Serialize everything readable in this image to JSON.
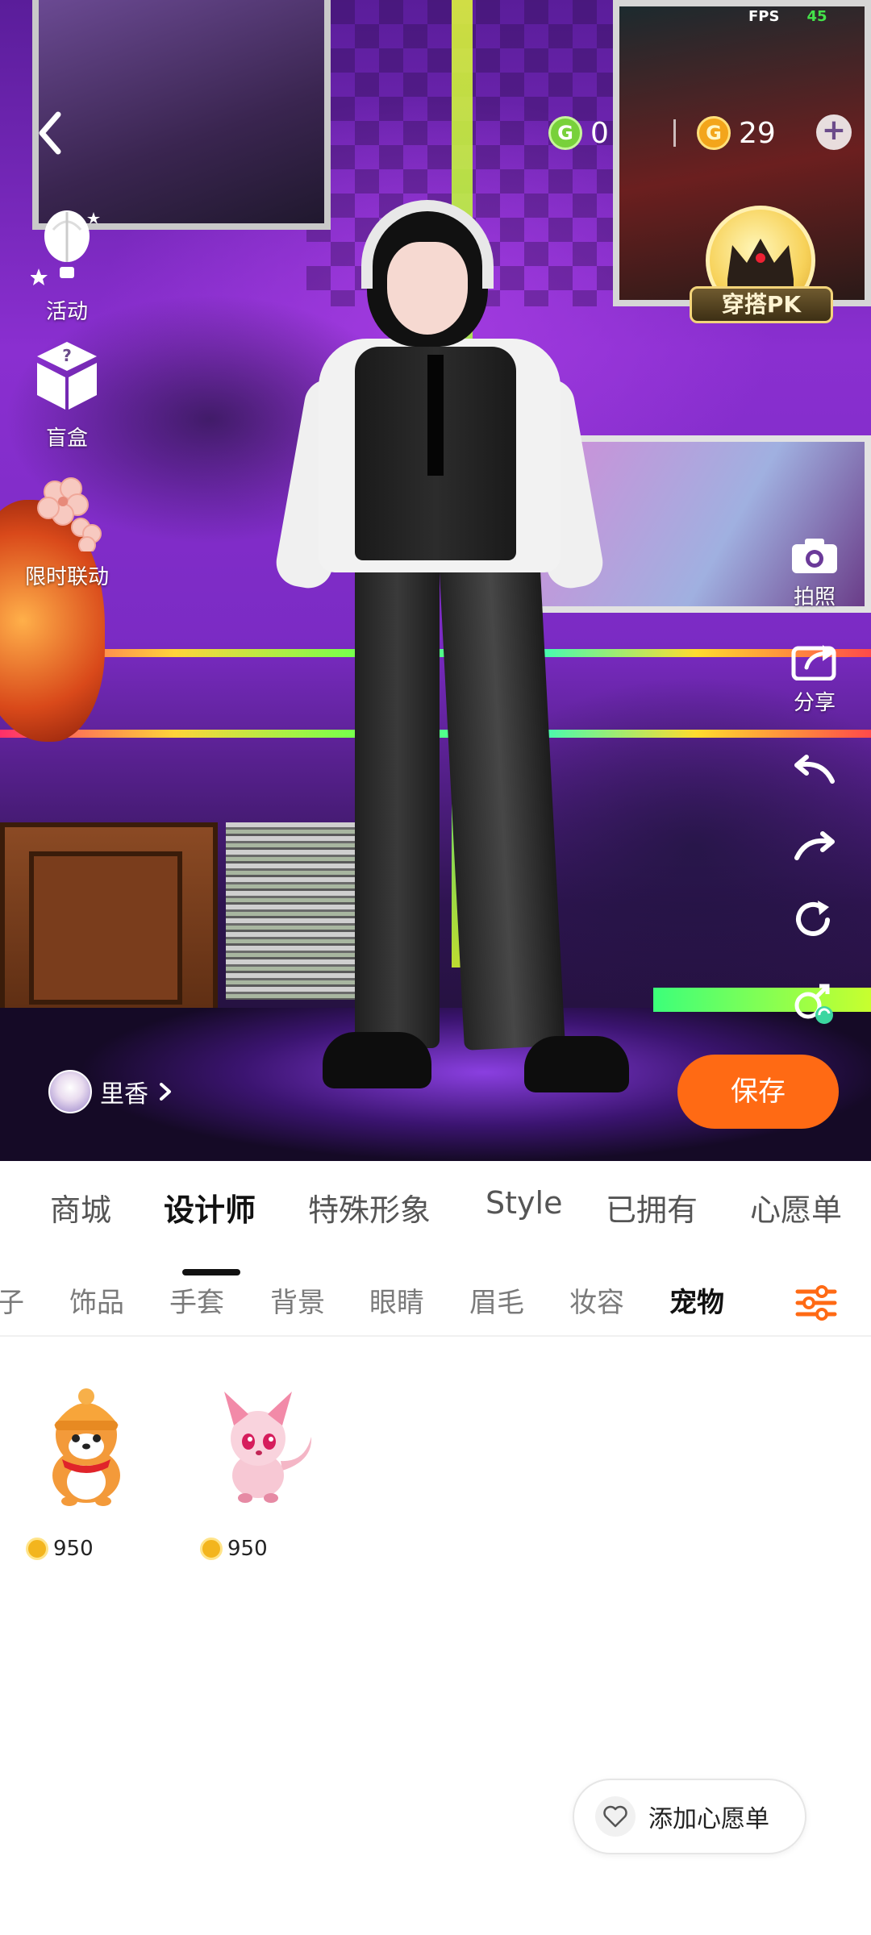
{
  "hud": {
    "fps_label": "FPS",
    "fps_value": "45"
  },
  "currency": {
    "green_amount": "0",
    "gold_amount": "29",
    "green_symbol": "G",
    "gold_symbol": "G"
  },
  "side_menu": {
    "activity_label": "活动",
    "blind_box_label": "盲盒",
    "collab_label": "限时联动"
  },
  "pk_badge": {
    "label": "穿搭PK"
  },
  "tools": {
    "photo_label": "拍照",
    "share_label": "分享"
  },
  "profile": {
    "name": "里香"
  },
  "save_button": {
    "label": "保存"
  },
  "main_tabs": [
    "商城",
    "设计师",
    "特殊形象",
    "Style",
    "已拥有",
    "心愿单"
  ],
  "main_tab_active": "设计师",
  "sub_tabs": [
    "子",
    "饰品",
    "手套",
    "背景",
    "眼睛",
    "眉毛",
    "妆容",
    "宠物"
  ],
  "sub_tab_active": "宠物",
  "items": [
    {
      "name": "shiba-pet",
      "price": "950"
    },
    {
      "name": "pink-fox-pet",
      "price": "950"
    }
  ],
  "wishlist_button": {
    "label": "添加心愿单"
  },
  "colors": {
    "accent_orange": "#ff6a14",
    "coin_gold": "#f3b51e",
    "fps_green": "#44e24a"
  }
}
